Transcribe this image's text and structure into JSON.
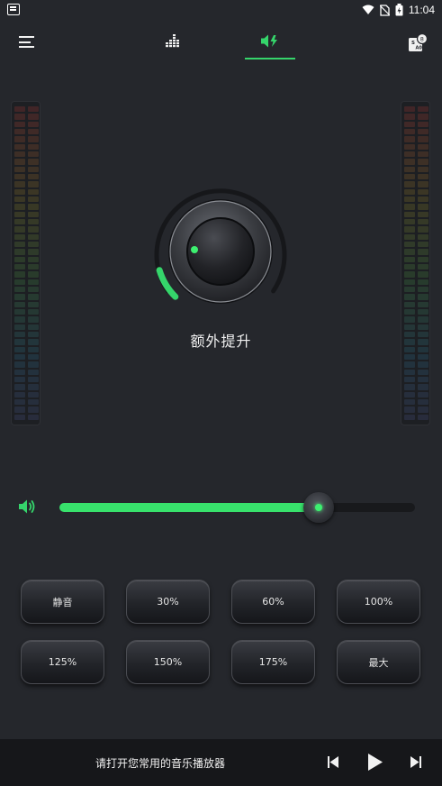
{
  "status_bar": {
    "time": "11:04"
  },
  "nav": {
    "menu_icon": "hamburger-menu-icon",
    "tabs": [
      {
        "icon": "equalizer-icon",
        "active": false
      },
      {
        "icon": "volume-boost-icon",
        "active": true
      }
    ],
    "album_icon": "music-album-icon",
    "badge": "8"
  },
  "knob": {
    "label": "额外提升",
    "level": 0.05,
    "accent_color": "#35d56b"
  },
  "volume": {
    "icon": "speaker-icon",
    "level": 0.73,
    "accent_color": "#38e26c"
  },
  "presets": [
    {
      "label": "静音"
    },
    {
      "label": "30%"
    },
    {
      "label": "60%"
    },
    {
      "label": "100%"
    },
    {
      "label": "125%"
    },
    {
      "label": "150%"
    },
    {
      "label": "175%"
    },
    {
      "label": "最大"
    }
  ],
  "player": {
    "message": "请打开您常用的音乐播放器",
    "prev_icon": "skip-previous-icon",
    "play_icon": "play-icon",
    "next_icon": "skip-next-icon"
  }
}
